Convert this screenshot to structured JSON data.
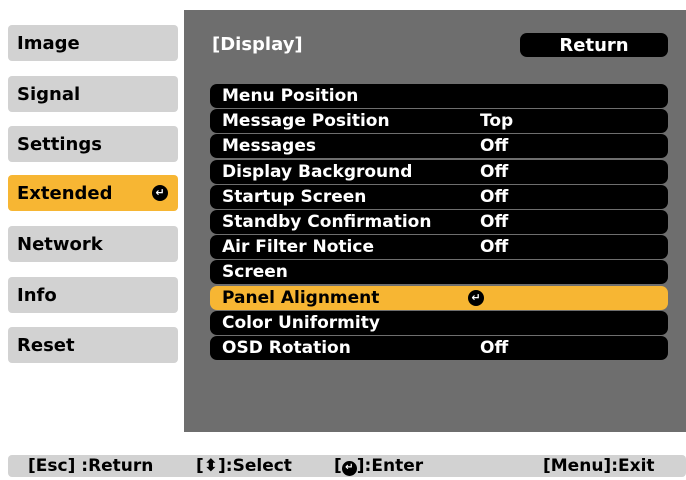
{
  "sidebar": {
    "items": [
      {
        "label": "Image"
      },
      {
        "label": "Signal"
      },
      {
        "label": "Settings"
      },
      {
        "label": "Extended",
        "active": true
      },
      {
        "label": "Network"
      },
      {
        "label": "Info"
      },
      {
        "label": "Reset"
      }
    ]
  },
  "panel": {
    "title": "[Display]",
    "return_label": "Return",
    "rows": [
      {
        "label": "Menu Position",
        "value": ""
      },
      {
        "label": "Message Position",
        "value": "Top"
      },
      {
        "label": "Messages",
        "value": "Off"
      },
      {
        "label": "Display Background",
        "value": "Off"
      },
      {
        "label": "Startup Screen",
        "value": "Off"
      },
      {
        "label": "Standby Confirmation",
        "value": "Off"
      },
      {
        "label": "Air Filter Notice",
        "value": "Off"
      },
      {
        "label": "Screen",
        "value": ""
      },
      {
        "label": "Panel Alignment",
        "value": "",
        "selected": true
      },
      {
        "label": "Color Uniformity",
        "value": ""
      },
      {
        "label": "OSD Rotation",
        "value": "Off"
      }
    ]
  },
  "help": {
    "return": "[Esc] :Return",
    "select_open": "[",
    "select_close": "]:Select",
    "enter_open": "[",
    "enter_close": "]:Enter",
    "exit": "[Menu]:Exit"
  },
  "colors": {
    "highlight": "#f7b633",
    "sidebar": "#d2d2d2",
    "panel": "#6e6e6e",
    "row": "#000000"
  },
  "icons": {
    "enter": "enter-icon",
    "select": "up-down-arrow-icon"
  }
}
